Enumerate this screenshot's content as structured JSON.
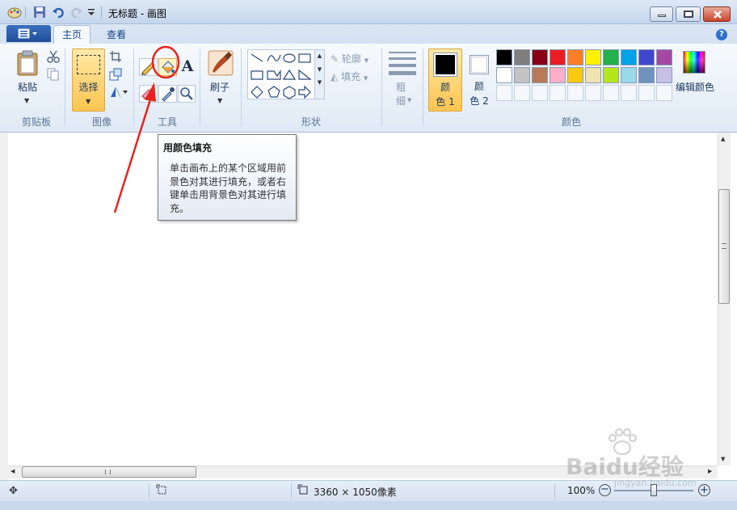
{
  "window": {
    "title": "无标题 - 画图"
  },
  "tabs": {
    "home": "主页",
    "view": "查看"
  },
  "ribbon": {
    "clipboard": {
      "paste_label": "粘贴",
      "group_label": "剪贴板"
    },
    "image": {
      "select_label": "选择",
      "group_label": "图像"
    },
    "tools": {
      "group_label": "工具"
    },
    "brushes": {
      "label": "刷子"
    },
    "shapes": {
      "outline_label": "轮廓",
      "fill_label": "填充",
      "group_label": "形状"
    },
    "size": {
      "label_1": "粗",
      "label_2": "细"
    },
    "colors": {
      "color1_label_1": "颜",
      "color1_label_2": "色 1",
      "color2_label_1": "颜",
      "color2_label_2": "色 2",
      "edit_label": "编辑颜色",
      "group_label": "颜色",
      "color1": "#000000",
      "color2": "#ffffff",
      "palette_row1": [
        "#000000",
        "#7f7f7f",
        "#880015",
        "#ed1c24",
        "#ff7f27",
        "#fff200",
        "#22b14c",
        "#00a2e8",
        "#3f48cc",
        "#a349a4"
      ],
      "palette_row2": [
        "#ffffff",
        "#c3c3c3",
        "#b97a57",
        "#ffaec9",
        "#ffc90e",
        "#efe4b0",
        "#b5e61d",
        "#99d9ea",
        "#7092be",
        "#c8bfe7"
      ]
    }
  },
  "tooltip": {
    "title": "用颜色填充",
    "body": "单击画布上的某个区域用前景色对其进行填充，或者右键单击用背景色对其进行填充。"
  },
  "statusbar": {
    "dimensions": "3360 × 1050像素",
    "zoom": "100%"
  },
  "watermark": {
    "text": "Baidu经验",
    "url": "jingyan.baidu.com"
  },
  "accent": {
    "annotation_red": "#e8231f",
    "ribbon_blue": "#1e395b"
  }
}
